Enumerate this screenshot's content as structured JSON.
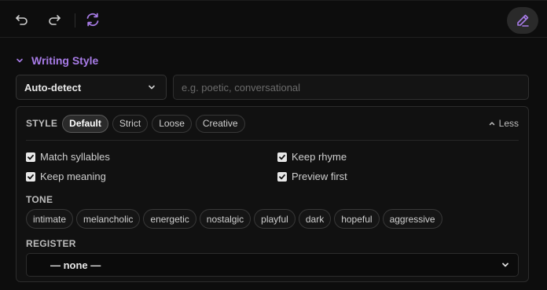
{
  "toolbar": {
    "undo_icon": "undo-icon",
    "redo_icon": "redo-icon",
    "refresh_icon": "refresh-icon",
    "pen_icon": "pen-icon",
    "accent": "#a77be6"
  },
  "section": {
    "title": "Writing Style",
    "chevron": "chevron-down-icon"
  },
  "style_select": {
    "value": "Auto-detect"
  },
  "custom_input": {
    "placeholder": "e.g. poetic, conversational",
    "value": ""
  },
  "panel": {
    "style_label": "STYLE",
    "style_options": [
      "Default",
      "Strict",
      "Loose",
      "Creative"
    ],
    "style_selected": "Default",
    "less_label": "Less",
    "checkboxes": [
      {
        "label": "Match syllables",
        "checked": true
      },
      {
        "label": "Keep rhyme",
        "checked": true
      },
      {
        "label": "Keep meaning",
        "checked": true
      },
      {
        "label": "Preview first",
        "checked": true
      }
    ],
    "tone_label": "TONE",
    "tones": [
      "intimate",
      "melancholic",
      "energetic",
      "nostalgic",
      "playful",
      "dark",
      "hopeful",
      "aggressive"
    ],
    "register_label": "REGISTER",
    "register_value": "— none —"
  }
}
